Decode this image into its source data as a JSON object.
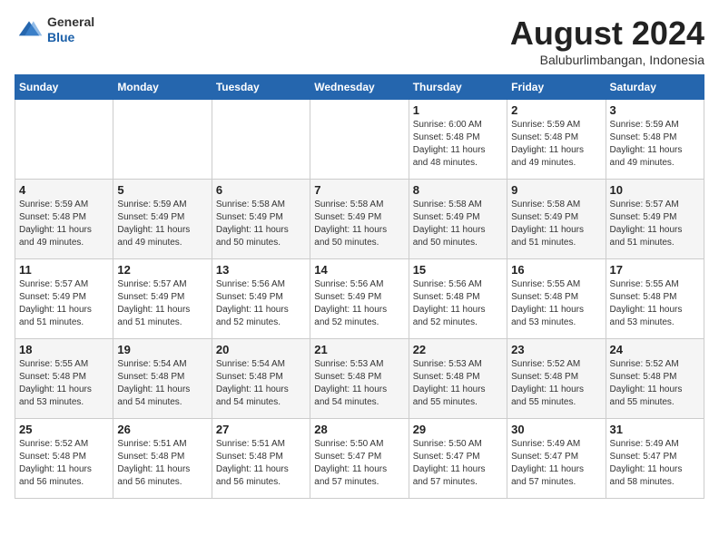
{
  "header": {
    "logo_general": "General",
    "logo_blue": "Blue",
    "month_year": "August 2024",
    "location": "Baluburlimbangan, Indonesia"
  },
  "weekdays": [
    "Sunday",
    "Monday",
    "Tuesday",
    "Wednesday",
    "Thursday",
    "Friday",
    "Saturday"
  ],
  "weeks": [
    [
      {
        "day": "",
        "info": ""
      },
      {
        "day": "",
        "info": ""
      },
      {
        "day": "",
        "info": ""
      },
      {
        "day": "",
        "info": ""
      },
      {
        "day": "1",
        "info": "Sunrise: 6:00 AM\nSunset: 5:48 PM\nDaylight: 11 hours\nand 48 minutes."
      },
      {
        "day": "2",
        "info": "Sunrise: 5:59 AM\nSunset: 5:48 PM\nDaylight: 11 hours\nand 49 minutes."
      },
      {
        "day": "3",
        "info": "Sunrise: 5:59 AM\nSunset: 5:48 PM\nDaylight: 11 hours\nand 49 minutes."
      }
    ],
    [
      {
        "day": "4",
        "info": "Sunrise: 5:59 AM\nSunset: 5:48 PM\nDaylight: 11 hours\nand 49 minutes."
      },
      {
        "day": "5",
        "info": "Sunrise: 5:59 AM\nSunset: 5:49 PM\nDaylight: 11 hours\nand 49 minutes."
      },
      {
        "day": "6",
        "info": "Sunrise: 5:58 AM\nSunset: 5:49 PM\nDaylight: 11 hours\nand 50 minutes."
      },
      {
        "day": "7",
        "info": "Sunrise: 5:58 AM\nSunset: 5:49 PM\nDaylight: 11 hours\nand 50 minutes."
      },
      {
        "day": "8",
        "info": "Sunrise: 5:58 AM\nSunset: 5:49 PM\nDaylight: 11 hours\nand 50 minutes."
      },
      {
        "day": "9",
        "info": "Sunrise: 5:58 AM\nSunset: 5:49 PM\nDaylight: 11 hours\nand 51 minutes."
      },
      {
        "day": "10",
        "info": "Sunrise: 5:57 AM\nSunset: 5:49 PM\nDaylight: 11 hours\nand 51 minutes."
      }
    ],
    [
      {
        "day": "11",
        "info": "Sunrise: 5:57 AM\nSunset: 5:49 PM\nDaylight: 11 hours\nand 51 minutes."
      },
      {
        "day": "12",
        "info": "Sunrise: 5:57 AM\nSunset: 5:49 PM\nDaylight: 11 hours\nand 51 minutes."
      },
      {
        "day": "13",
        "info": "Sunrise: 5:56 AM\nSunset: 5:49 PM\nDaylight: 11 hours\nand 52 minutes."
      },
      {
        "day": "14",
        "info": "Sunrise: 5:56 AM\nSunset: 5:49 PM\nDaylight: 11 hours\nand 52 minutes."
      },
      {
        "day": "15",
        "info": "Sunrise: 5:56 AM\nSunset: 5:48 PM\nDaylight: 11 hours\nand 52 minutes."
      },
      {
        "day": "16",
        "info": "Sunrise: 5:55 AM\nSunset: 5:48 PM\nDaylight: 11 hours\nand 53 minutes."
      },
      {
        "day": "17",
        "info": "Sunrise: 5:55 AM\nSunset: 5:48 PM\nDaylight: 11 hours\nand 53 minutes."
      }
    ],
    [
      {
        "day": "18",
        "info": "Sunrise: 5:55 AM\nSunset: 5:48 PM\nDaylight: 11 hours\nand 53 minutes."
      },
      {
        "day": "19",
        "info": "Sunrise: 5:54 AM\nSunset: 5:48 PM\nDaylight: 11 hours\nand 54 minutes."
      },
      {
        "day": "20",
        "info": "Sunrise: 5:54 AM\nSunset: 5:48 PM\nDaylight: 11 hours\nand 54 minutes."
      },
      {
        "day": "21",
        "info": "Sunrise: 5:53 AM\nSunset: 5:48 PM\nDaylight: 11 hours\nand 54 minutes."
      },
      {
        "day": "22",
        "info": "Sunrise: 5:53 AM\nSunset: 5:48 PM\nDaylight: 11 hours\nand 55 minutes."
      },
      {
        "day": "23",
        "info": "Sunrise: 5:52 AM\nSunset: 5:48 PM\nDaylight: 11 hours\nand 55 minutes."
      },
      {
        "day": "24",
        "info": "Sunrise: 5:52 AM\nSunset: 5:48 PM\nDaylight: 11 hours\nand 55 minutes."
      }
    ],
    [
      {
        "day": "25",
        "info": "Sunrise: 5:52 AM\nSunset: 5:48 PM\nDaylight: 11 hours\nand 56 minutes."
      },
      {
        "day": "26",
        "info": "Sunrise: 5:51 AM\nSunset: 5:48 PM\nDaylight: 11 hours\nand 56 minutes."
      },
      {
        "day": "27",
        "info": "Sunrise: 5:51 AM\nSunset: 5:48 PM\nDaylight: 11 hours\nand 56 minutes."
      },
      {
        "day": "28",
        "info": "Sunrise: 5:50 AM\nSunset: 5:47 PM\nDaylight: 11 hours\nand 57 minutes."
      },
      {
        "day": "29",
        "info": "Sunrise: 5:50 AM\nSunset: 5:47 PM\nDaylight: 11 hours\nand 57 minutes."
      },
      {
        "day": "30",
        "info": "Sunrise: 5:49 AM\nSunset: 5:47 PM\nDaylight: 11 hours\nand 57 minutes."
      },
      {
        "day": "31",
        "info": "Sunrise: 5:49 AM\nSunset: 5:47 PM\nDaylight: 11 hours\nand 58 minutes."
      }
    ]
  ]
}
